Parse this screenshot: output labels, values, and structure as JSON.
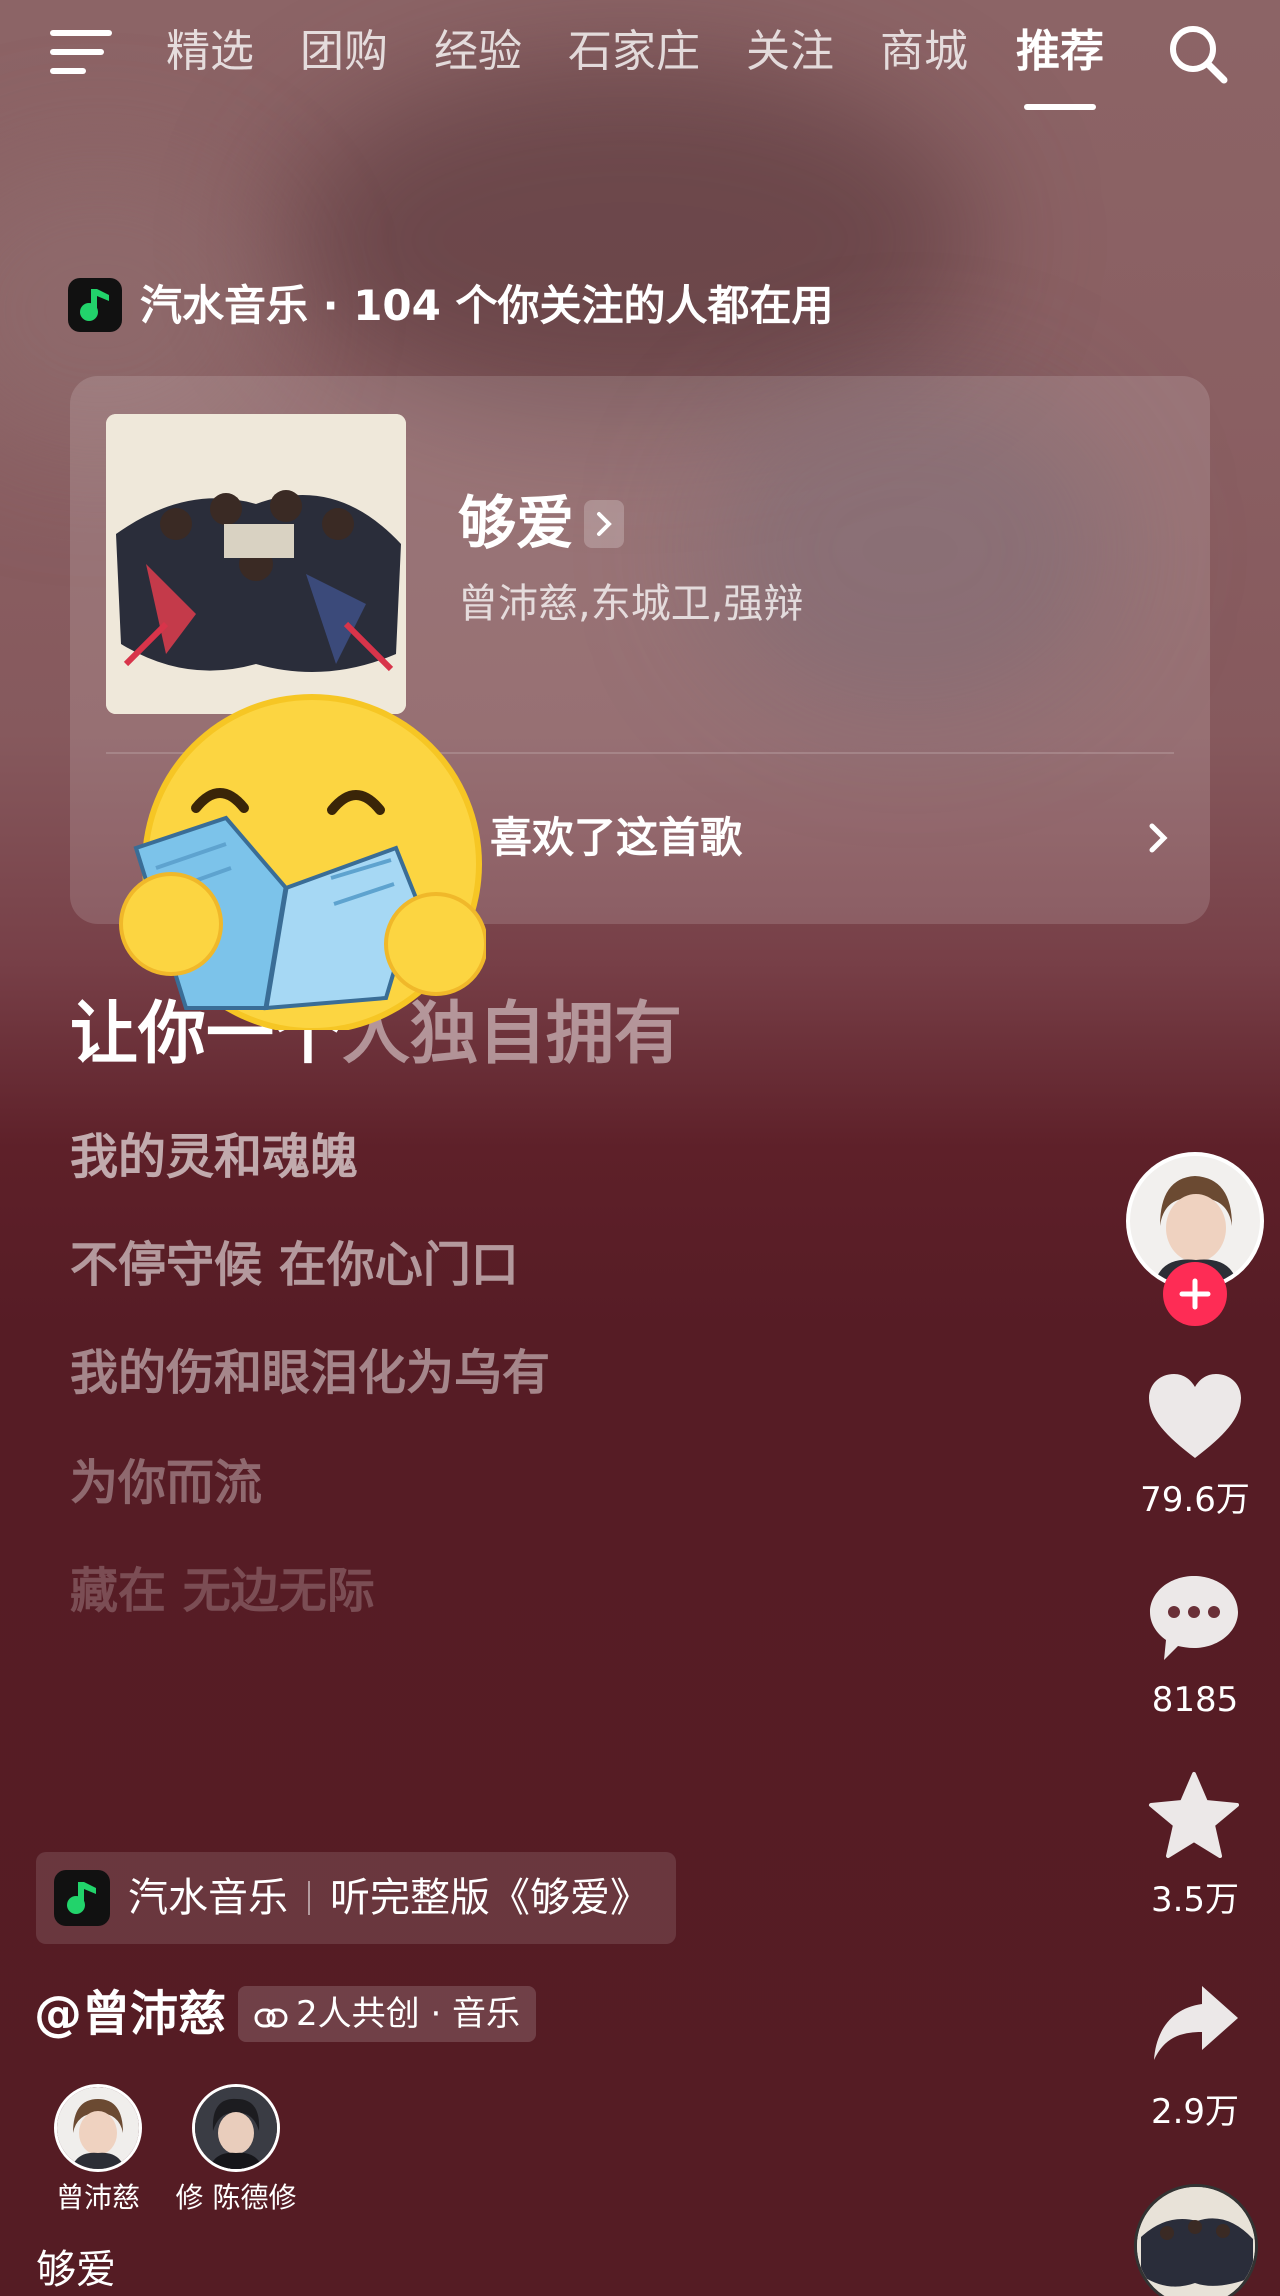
{
  "top_nav": {
    "tabs": [
      "精选",
      "团购",
      "经验",
      "石家庄",
      "关注",
      "商城",
      "推荐"
    ],
    "active_tab": "推荐"
  },
  "app_banner": {
    "text": "汽水音乐 · 104 个你关注的人都在用"
  },
  "music_card": {
    "song_title": "够爱",
    "artists": "曾沛慈,东城卫,强辩",
    "liked_text": "喜欢了这首歌"
  },
  "lyrics": {
    "current_sung": "让你一个",
    "current_unsung": "人独自拥有",
    "lines": [
      "我的灵和魂魄",
      "不停守候 在你心门口",
      "我的伤和眼泪化为乌有",
      "为你而流",
      "藏在 无边无际"
    ]
  },
  "right_rail": {
    "likes": "79.6万",
    "comments": "8185",
    "favorites": "3.5万",
    "shares": "2.9万"
  },
  "music_pill": {
    "app_name": "汽水音乐",
    "action": "听完整版《够爱》"
  },
  "author": {
    "handle": "@曾沛慈",
    "collab": "2人共创 · 音乐"
  },
  "creators": [
    {
      "name": "曾沛慈"
    },
    {
      "name": "修 陈德修"
    }
  ],
  "caption": "够爱",
  "colors": {
    "background": "#551c24",
    "follow": "#fe2c55",
    "app_logo_green": "#22d36b"
  }
}
